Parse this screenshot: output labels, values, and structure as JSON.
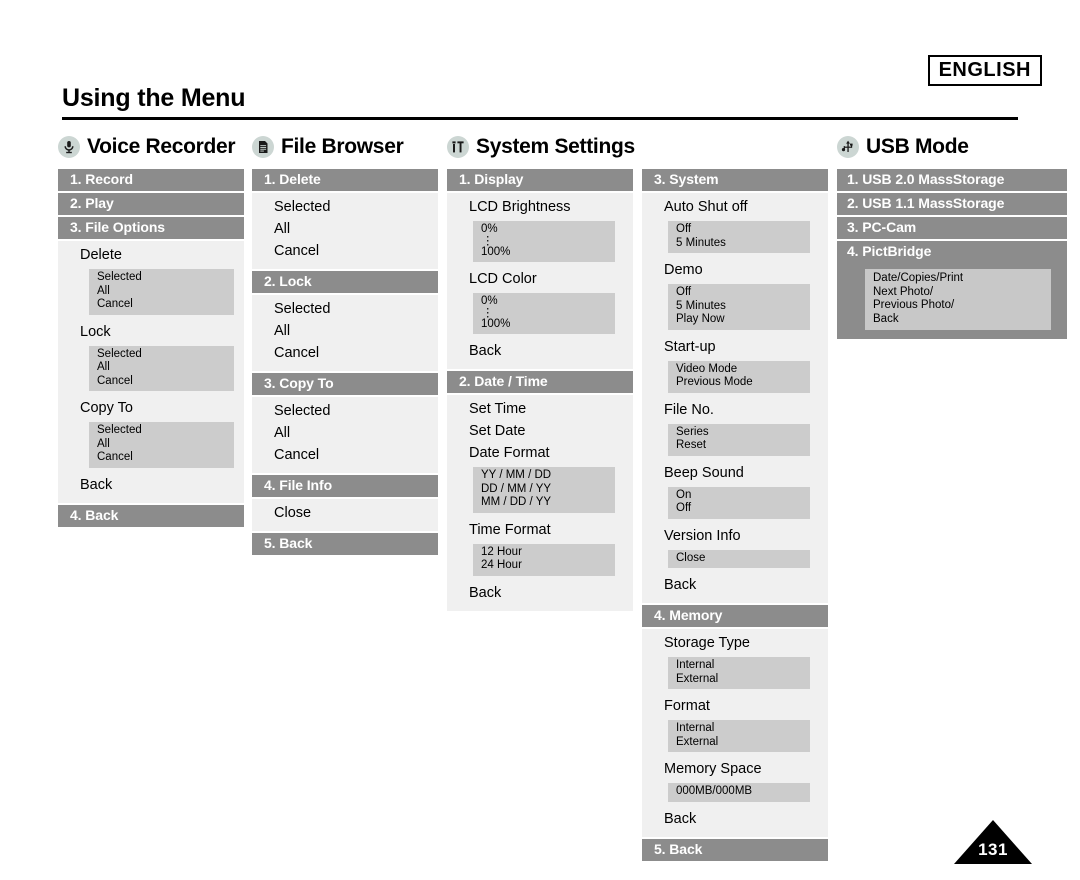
{
  "language_badge": "ENGLISH",
  "page_title": "Using the Menu",
  "page_number": "131",
  "columns": [
    {
      "icon": "microphone-icon",
      "title": "Voice Recorder",
      "sections": [
        {
          "header": "1. Record"
        },
        {
          "header": "2. Play"
        },
        {
          "header": "3. File Options",
          "options": [
            {
              "label": "Delete",
              "subs": [
                "Selected",
                "All",
                "Cancel"
              ]
            },
            {
              "label": "Lock",
              "subs": [
                "Selected",
                "All",
                "Cancel"
              ]
            },
            {
              "label": "Copy To",
              "subs": [
                "Selected",
                "All",
                "Cancel"
              ]
            },
            {
              "label": "Back"
            }
          ]
        },
        {
          "header": "4. Back"
        }
      ]
    },
    {
      "icon": "document-icon",
      "title": "File Browser",
      "sections": [
        {
          "header": "1. Delete",
          "options": [
            {
              "label": "Selected"
            },
            {
              "label": "All"
            },
            {
              "label": "Cancel"
            }
          ]
        },
        {
          "header": "2. Lock",
          "options": [
            {
              "label": "Selected"
            },
            {
              "label": "All"
            },
            {
              "label": "Cancel"
            }
          ]
        },
        {
          "header": "3. Copy To",
          "options": [
            {
              "label": "Selected"
            },
            {
              "label": "All"
            },
            {
              "label": "Cancel"
            }
          ]
        },
        {
          "header": "4. File Info",
          "options": [
            {
              "label": "Close"
            }
          ]
        },
        {
          "header": "5. Back"
        }
      ]
    },
    {
      "icon": "settings-tools-icon",
      "title": "System Settings",
      "sections": [
        {
          "header": "1. Display",
          "options": [
            {
              "label": "LCD Brightness",
              "subs": [
                "0%",
                "⋮",
                "100%"
              ]
            },
            {
              "label": "LCD Color",
              "subs": [
                "0%",
                "⋮",
                "100%"
              ]
            },
            {
              "label": "Back"
            }
          ]
        },
        {
          "header": "2. Date / Time",
          "options": [
            {
              "label": "Set Time"
            },
            {
              "label": "Set Date"
            },
            {
              "label": "Date Format",
              "subs": [
                "YY / MM / DD",
                "DD / MM / YY",
                "MM / DD / YY"
              ]
            },
            {
              "label": "Time Format",
              "subs": [
                "12 Hour",
                "24 Hour"
              ]
            },
            {
              "label": "Back"
            }
          ]
        }
      ]
    },
    {
      "icon": "",
      "title": "",
      "sections": [
        {
          "header": "3. System",
          "options": [
            {
              "label": "Auto Shut off",
              "subs": [
                "Off",
                "5 Minutes"
              ]
            },
            {
              "label": "Demo",
              "subs": [
                "Off",
                "5 Minutes",
                "Play Now"
              ]
            },
            {
              "label": "Start-up",
              "subs": [
                "Video Mode",
                "Previous Mode"
              ]
            },
            {
              "label": "File No.",
              "subs": [
                "Series",
                "Reset"
              ]
            },
            {
              "label": "Beep Sound",
              "subs": [
                "On",
                "Off"
              ]
            },
            {
              "label": "Version Info",
              "subs": [
                "Close"
              ]
            },
            {
              "label": "Back"
            }
          ]
        },
        {
          "header": "4. Memory",
          "options": [
            {
              "label": "Storage Type",
              "subs": [
                "Internal",
                "External"
              ]
            },
            {
              "label": "Format",
              "subs": [
                "Internal",
                "External"
              ]
            },
            {
              "label": "Memory Space",
              "subs": [
                "000MB/000MB"
              ]
            },
            {
              "label": "Back"
            }
          ]
        },
        {
          "header": "5. Back"
        }
      ]
    },
    {
      "icon": "usb-icon",
      "title": "USB Mode",
      "sections": [
        {
          "header": "1. USB 2.0 MassStorage"
        },
        {
          "header": "2. USB 1.1 MassStorage"
        },
        {
          "header": "3. PC-Cam"
        },
        {
          "header": "4. PictBridge",
          "dark_subs": [
            "Date/Copies/Print",
            "Next Photo/",
            "Previous Photo/",
            "Back"
          ]
        }
      ]
    }
  ],
  "colors": {
    "section_header_bg": "#8c8c8c",
    "section_body_bg": "#f0f0f0",
    "sub_box_bg": "#cccccc",
    "icon_circle_bg": "#ccd6d3",
    "text": "#000000",
    "header_text": "#ffffff"
  }
}
